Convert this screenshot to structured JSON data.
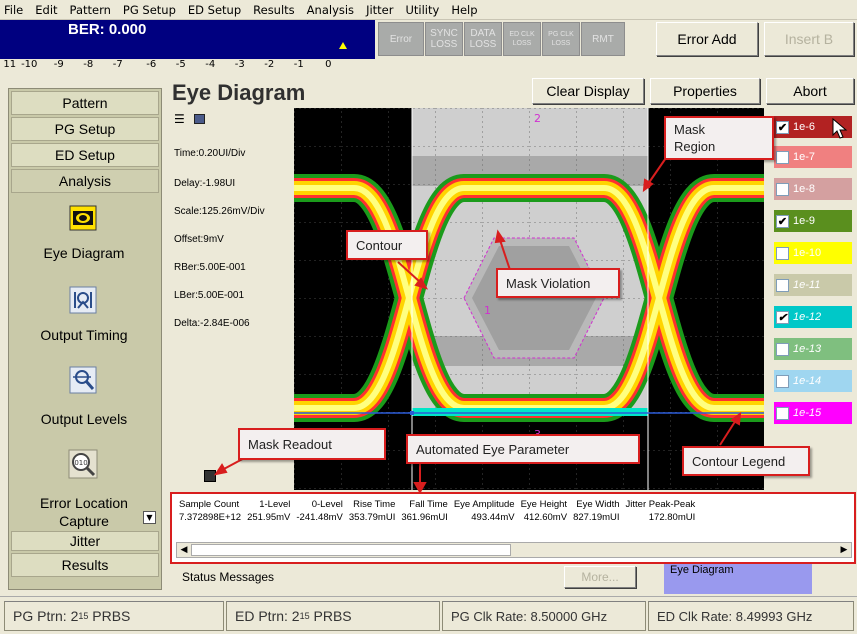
{
  "menu": [
    "File",
    "Edit",
    "Pattern",
    "PG Setup",
    "ED Setup",
    "Results",
    "Analysis",
    "Jitter",
    "Utility",
    "Help"
  ],
  "ber": {
    "title": "BER: 0.000",
    "scale": [
      "11",
      "-10",
      "-9",
      "-8",
      "-7",
      "-6",
      "-5",
      "-4",
      "-3",
      "-2",
      "-1",
      "0"
    ]
  },
  "indicators": {
    "error": "Error",
    "sync_loss": "SYNC\nLOSS",
    "data_loss": "DATA\nLOSS",
    "ed_clk_loss": "ED CLK\nLOSS",
    "pg_clk_loss": "PG CLK\nLOSS",
    "rmt": "RMT"
  },
  "buttons": {
    "error_add": "Error Add",
    "insert_b": "Insert B",
    "clear_display": "Clear Display",
    "properties": "Properties",
    "abort": "Abort",
    "more": "More..."
  },
  "nav": {
    "pattern": "Pattern",
    "pg_setup": "PG Setup",
    "ed_setup": "ED Setup",
    "analysis": "Analysis",
    "eye_diagram": "Eye Diagram",
    "output_timing": "Output Timing",
    "output_levels": "Output Levels",
    "error_location": "Error Location",
    "capture": "Capture",
    "jitter": "Jitter",
    "results": "Results"
  },
  "eye": {
    "title": "Eye Diagram",
    "readouts": {
      "time": "Time:0.20UI/Div",
      "delay": "Delay:-1.98UI",
      "scale": "Scale:125.26mV/Div",
      "offset": "Offset:9mV",
      "rber": "RBer:5.00E-001",
      "lber": "LBer:5.00E-001",
      "delta": "Delta:-2.84E-006"
    },
    "markers": {
      "m1": "1",
      "m2": "2",
      "m3": "3"
    }
  },
  "contours": [
    {
      "label": "1e-6",
      "checked": true,
      "color": "#b22222"
    },
    {
      "label": "1e-7",
      "checked": false,
      "color": "#f08080"
    },
    {
      "label": "1e-8",
      "checked": false,
      "color": "#d4a0a0"
    },
    {
      "label": "1e-9",
      "checked": true,
      "color": "#5a8f1e"
    },
    {
      "label": "1e-10",
      "checked": false,
      "color": "#ffff00"
    },
    {
      "label": "1e-11",
      "checked": false,
      "color": "#c9c9a9"
    },
    {
      "label": "1e-12",
      "checked": true,
      "color": "#00c8c8"
    },
    {
      "label": "1e-13",
      "checked": false,
      "color": "#7fbf7f"
    },
    {
      "label": "1e-14",
      "checked": false,
      "color": "#9fd6f0"
    },
    {
      "label": "1e-15",
      "checked": false,
      "color": "#ff00ff"
    }
  ],
  "params": {
    "headers": [
      "Sample Count",
      "1-Level",
      "0-Level",
      "Rise Time",
      "Fall Time",
      "Eye Amplitude",
      "Eye Height",
      "Eye Width",
      "Jitter Peak-Peak"
    ],
    "values": [
      "7.372898E+12",
      "251.95mV",
      "-241.48mV",
      "353.79mUI",
      "361.96mUI",
      "493.44mV",
      "412.60mV",
      "827.19mUI",
      "172.80mUI"
    ]
  },
  "status": {
    "messages": "Status Messages",
    "eye_diagram_tab": "Eye Diagram"
  },
  "bottom": {
    "pg_ptrn": "PG Ptrn: 2",
    "pg_ptrn_exp": "15",
    "pg_ptrn_suffix": " PRBS",
    "ed_ptrn": "ED Ptrn: 2",
    "ed_ptrn_exp": "15",
    "ed_ptrn_suffix": " PRBS",
    "pg_clk": "PG Clk Rate: 8.50000 GHz",
    "ed_clk": "ED Clk Rate: 8.49993 GHz"
  },
  "callouts": {
    "mask_region": "Mask\nRegion",
    "contour": "Contour",
    "mask_violation": "Mask Violation",
    "mask_readout": "Mask Readout",
    "automated_eye": "Automated Eye Parameter",
    "contour_legend": "Contour Legend"
  },
  "colors": {
    "accent_red": "#d81e1e",
    "ber_bg": "#000080",
    "panel_bg": "#c9c9a9"
  }
}
